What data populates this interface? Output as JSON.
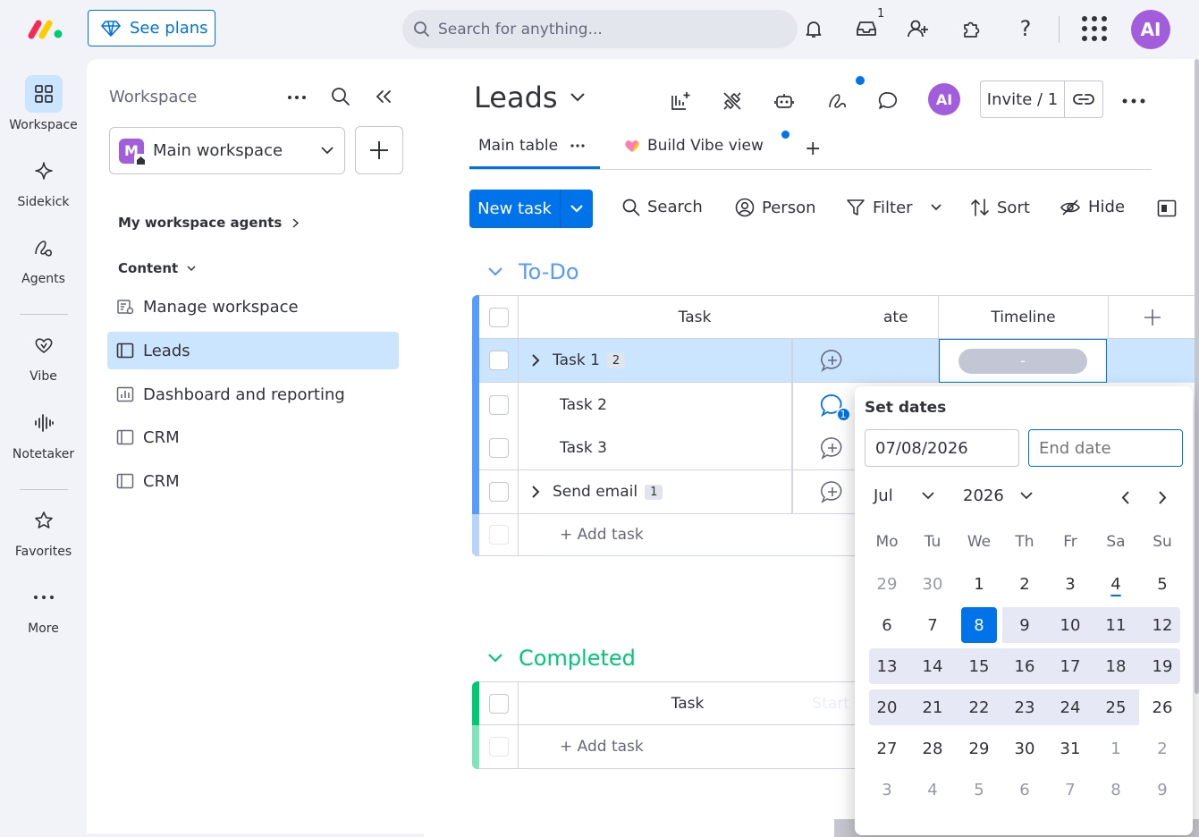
{
  "topbar": {
    "see_plans": "See plans",
    "search_placeholder": "Search for anything...",
    "inbox_count": "1",
    "avatar": "AI"
  },
  "nav": [
    {
      "label": "Workspace",
      "icon": "grid-icon"
    },
    {
      "label": "Sidekick",
      "icon": "sparkle-icon"
    },
    {
      "label": "Agents",
      "icon": "agents-icon"
    },
    {
      "label": "Vibe",
      "icon": "heart-icon"
    },
    {
      "label": "Notetaker",
      "icon": "waveform-icon"
    },
    {
      "label": "Favorites",
      "icon": "star-icon"
    },
    {
      "label": "More",
      "icon": "more-dots-icon"
    }
  ],
  "panel": {
    "title": "Workspace",
    "workspace_name": "Main workspace",
    "workspace_letter": "M",
    "agents_label": "My workspace agents",
    "content_label": "Content",
    "items": [
      {
        "label": "Manage workspace",
        "icon": "manage-icon"
      },
      {
        "label": "Leads",
        "icon": "board-icon",
        "selected": true
      },
      {
        "label": "Dashboard and reporting",
        "icon": "dashboard-icon"
      },
      {
        "label": "CRM",
        "icon": "board-icon"
      },
      {
        "label": "CRM",
        "icon": "board-icon"
      }
    ]
  },
  "board": {
    "title": "Leads",
    "avatar": "AI",
    "invite": "Invite / 1",
    "tabs": [
      {
        "label": "Main table"
      },
      {
        "label": "Build Vibe view"
      }
    ],
    "toolbar": {
      "new_task": "New task",
      "search": "Search",
      "person": "Person",
      "filter": "Filter",
      "sort": "Sort",
      "hide": "Hide"
    },
    "groups": {
      "todo": {
        "name": "To-Do",
        "color": "#579bfc",
        "columns": {
          "task": "Task",
          "date": "Start Date",
          "date_visible": "ate",
          "timeline": "Timeline"
        },
        "rows": [
          {
            "name": "Task 1",
            "subitems": "2"
          },
          {
            "name": "Task 2",
            "updates": "1"
          },
          {
            "name": "Task 3"
          },
          {
            "name": "Send email",
            "subitems": "1"
          }
        ],
        "timeline_value": "-",
        "add_task": "+ Add task"
      },
      "completed": {
        "name": "Completed",
        "color": "#00c875",
        "columns": {
          "task": "Task",
          "date": "Start"
        },
        "add_task": "+ Add task"
      }
    }
  },
  "datepicker": {
    "title": "Set dates",
    "start_value": "07/08/2026",
    "end_placeholder": "End date",
    "month": "Jul",
    "year": "2026",
    "weekdays": [
      "Mo",
      "Tu",
      "We",
      "Th",
      "Fr",
      "Sa",
      "Su"
    ],
    "weeks": [
      [
        "29",
        "30",
        "1",
        "2",
        "3",
        "4",
        "5"
      ],
      [
        "6",
        "7",
        "8",
        "9",
        "10",
        "11",
        "12"
      ],
      [
        "13",
        "14",
        "15",
        "16",
        "17",
        "18",
        "19"
      ],
      [
        "20",
        "21",
        "22",
        "23",
        "24",
        "25",
        "26"
      ],
      [
        "27",
        "28",
        "29",
        "30",
        "31",
        "1",
        "2"
      ],
      [
        "3",
        "4",
        "5",
        "6",
        "7",
        "8",
        "9"
      ]
    ],
    "selected_day": "8",
    "today": "4"
  },
  "colors": {
    "accent": "#0073ea",
    "selected_bg": "#cce5ff",
    "range_bg": "#e6e9f5"
  }
}
